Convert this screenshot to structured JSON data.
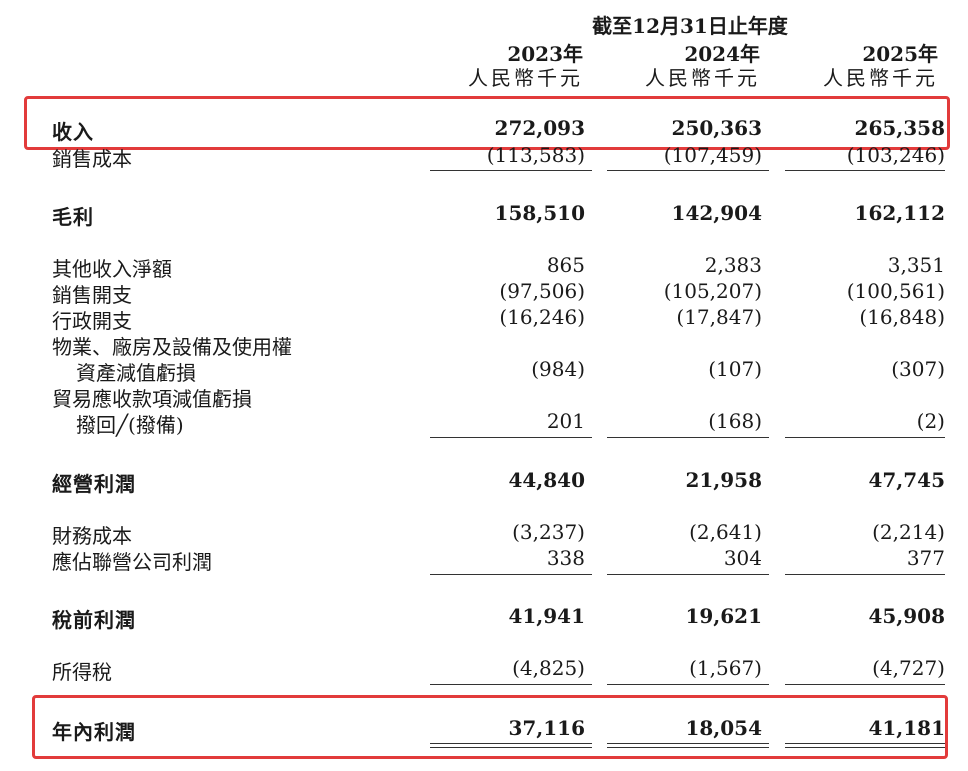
{
  "header": {
    "period": "截至12月31日止年度",
    "years": [
      "2023年",
      "2024年",
      "2025年"
    ],
    "unit": "人民幣千元"
  },
  "rows": [
    {
      "label": "收入",
      "values": [
        "272,093",
        "250,363",
        "265,358"
      ]
    },
    {
      "label": "銷售成本",
      "values": [
        "(113,583)",
        "(107,459)",
        "(103,246)"
      ]
    },
    {
      "label": "毛利",
      "values": [
        "158,510",
        "142,904",
        "162,112"
      ]
    },
    {
      "label": "其他收入淨額",
      "values": [
        "865",
        "2,383",
        "3,351"
      ]
    },
    {
      "label": "銷售開支",
      "values": [
        "(97,506)",
        "(105,207)",
        "(100,561)"
      ]
    },
    {
      "label": "行政開支",
      "values": [
        "(16,246)",
        "(17,847)",
        "(16,848)"
      ]
    },
    {
      "label": "物業、廠房及設備及使用權",
      "label2": "資產減值虧損",
      "values": [
        "(984)",
        "(107)",
        "(307)"
      ]
    },
    {
      "label": "貿易應收款項減值虧損",
      "label2": "撥回╱(撥備)",
      "values": [
        "201",
        "(168)",
        "(2)"
      ]
    },
    {
      "label": "經營利潤",
      "values": [
        "44,840",
        "21,958",
        "47,745"
      ]
    },
    {
      "label": "財務成本",
      "values": [
        "(3,237)",
        "(2,641)",
        "(2,214)"
      ]
    },
    {
      "label": "應佔聯營公司利潤",
      "values": [
        "338",
        "304",
        "377"
      ]
    },
    {
      "label": "稅前利潤",
      "values": [
        "41,941",
        "19,621",
        "45,908"
      ]
    },
    {
      "label": "所得稅",
      "values": [
        "(4,825)",
        "(1,567)",
        "(4,727)"
      ]
    },
    {
      "label": "年內利潤",
      "values": [
        "37,116",
        "18,054",
        "41,181"
      ]
    }
  ],
  "highlight_color": "#e23b3b"
}
